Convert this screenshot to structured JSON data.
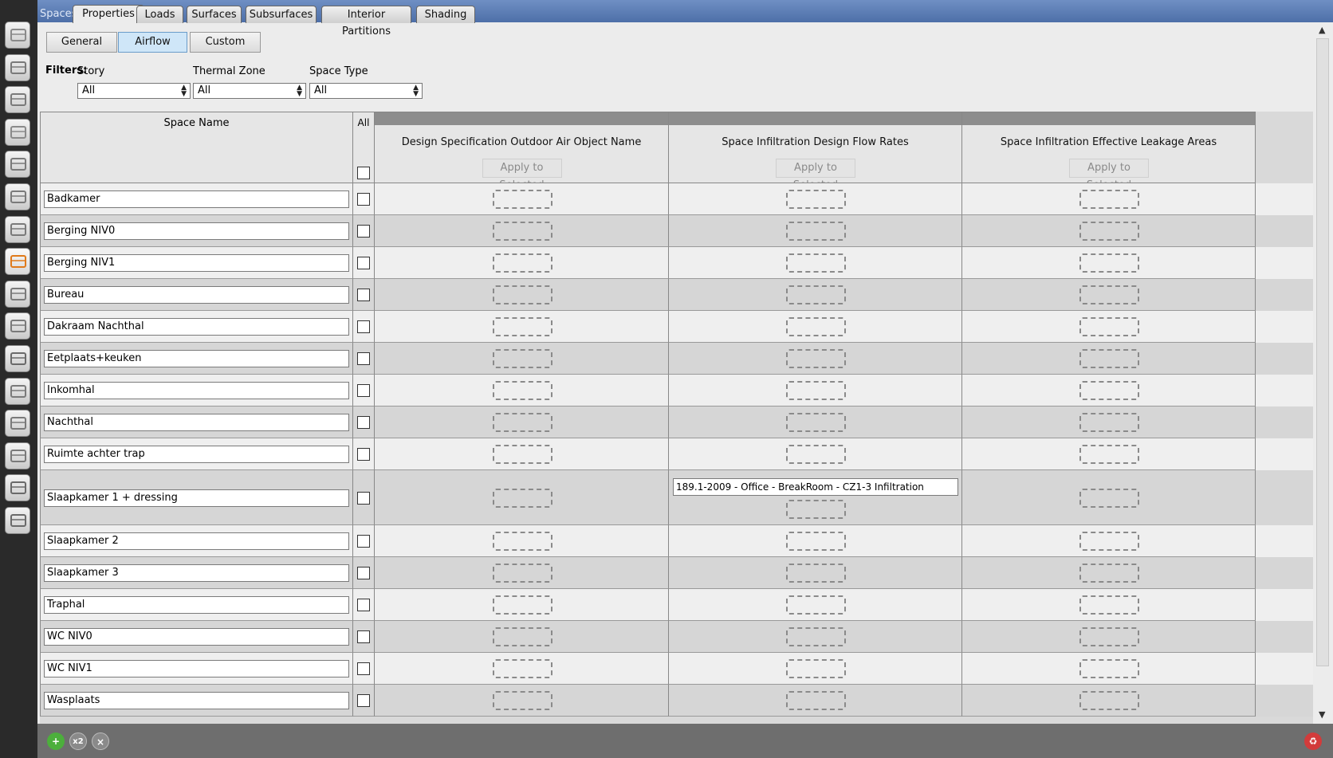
{
  "window": {
    "section_label": "Spaces",
    "tabs": [
      {
        "label": "Properties",
        "active": true
      },
      {
        "label": "Loads"
      },
      {
        "label": "Surfaces"
      },
      {
        "label": "Subsurfaces"
      },
      {
        "label": "Interior Partitions"
      },
      {
        "label": "Shading"
      }
    ]
  },
  "subtabs": [
    {
      "label": "General"
    },
    {
      "label": "Airflow",
      "active": true
    },
    {
      "label": "Custom"
    }
  ],
  "filters": {
    "label": "Filters:",
    "story": {
      "label": "Story",
      "value": "All"
    },
    "thermal_zone": {
      "label": "Thermal Zone",
      "value": "All"
    },
    "space_type": {
      "label": "Space Type",
      "value": "All"
    }
  },
  "grid": {
    "name_header": "Space Name",
    "all_header": "All",
    "columns": [
      {
        "title": "Design Specification Outdoor Air Object Name",
        "apply_label": "Apply to Selected"
      },
      {
        "title": "Space Infiltration Design Flow Rates",
        "apply_label": "Apply to Selected"
      },
      {
        "title": "Space Infiltration Effective Leakage Areas",
        "apply_label": "Apply to Selected"
      }
    ],
    "rows": [
      {
        "name": "Badkamer"
      },
      {
        "name": "Berging NIV0"
      },
      {
        "name": "Berging NIV1"
      },
      {
        "name": "Bureau"
      },
      {
        "name": "Dakraam Nachthal"
      },
      {
        "name": "Eetplaats+keuken"
      },
      {
        "name": "Inkomhal"
      },
      {
        "name": "Nachthal"
      },
      {
        "name": "Ruimte achter trap"
      },
      {
        "name": "Slaapkamer 1 + dressing",
        "infiltration_flow": "189.1-2009 - Office - BreakRoom - CZ1-3 Infiltration"
      },
      {
        "name": "Slaapkamer 2"
      },
      {
        "name": "Slaapkamer 3"
      },
      {
        "name": "Traphal"
      },
      {
        "name": "WC NIV0"
      },
      {
        "name": "WC NIV1"
      },
      {
        "name": "Wasplaats"
      }
    ]
  },
  "sidebar_icons": [
    "site-icon",
    "schedules-icon",
    "constructions-icon",
    "loads-icon",
    "space-types-icon",
    "geometry-icon",
    "facility-icon",
    "spaces-icon",
    "thermal-zones-icon",
    "hvac-systems-icon",
    "building-summary-icon",
    "measures-icon",
    "simulation-settings-icon",
    "scripts-icon",
    "run-icon",
    "results-icon"
  ],
  "bottom_bar": {
    "add_label": "+",
    "copy_label": "x2",
    "remove_label": "×",
    "purge_label": "♻"
  },
  "colors": {
    "active_subtab": "#cfe6f8",
    "tabbar": "#5a7cb5",
    "row_light": "#efefef",
    "row_dark": "#d6d6d6"
  }
}
